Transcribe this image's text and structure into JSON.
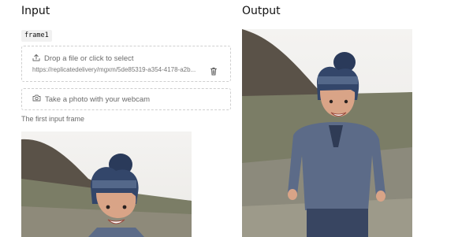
{
  "input": {
    "title": "Input",
    "param_name": "frame1",
    "dropzone_label": "Drop a file or click to select",
    "file_url": "https://replicatedelivery/mgxm/5de85319-a354-4178-a2b...",
    "webcam_label": "Take a photo with your webcam",
    "helper_text": "The first input frame",
    "image_alt": "Input frame photo of a smiling child in a knit hat"
  },
  "output": {
    "title": "Output",
    "image_alt": "Output frame photo of a smiling child in a knit hat"
  },
  "icons": {
    "upload": "upload-icon",
    "trash": "trash-icon",
    "camera": "camera-icon"
  },
  "colors": {
    "dashed_border": "#cfcfcf",
    "muted_text": "#6b6b6b",
    "tag_bg": "#f1f1f1"
  }
}
